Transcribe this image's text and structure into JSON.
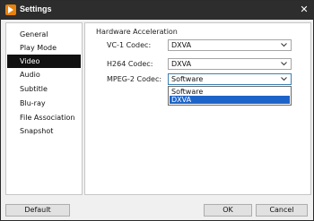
{
  "window": {
    "title": "Settings",
    "close_glyph": "✕"
  },
  "sidebar": {
    "items": [
      {
        "label": "General"
      },
      {
        "label": "Play Mode"
      },
      {
        "label": "Video"
      },
      {
        "label": "Audio"
      },
      {
        "label": "Subtitle"
      },
      {
        "label": "Blu-ray"
      },
      {
        "label": "File Association"
      },
      {
        "label": "Snapshot"
      }
    ],
    "selected": "Video"
  },
  "panel": {
    "section_title": "Hardware Acceleration",
    "rows": [
      {
        "label": "VC-1 Codec:",
        "value": "DXVA"
      },
      {
        "label": "H264 Codec:",
        "value": "DXVA"
      },
      {
        "label": "MPEG-2 Codec:",
        "value": "Software"
      }
    ],
    "open_dropdown": {
      "options": [
        "Software",
        "DXVA"
      ],
      "highlighted": "DXVA"
    }
  },
  "footer": {
    "default_label": "Default",
    "ok_label": "OK",
    "cancel_label": "Cancel"
  },
  "colors": {
    "titlebar": "#2d2d2d",
    "selected_nav": "#111111",
    "highlight": "#1e64c8",
    "app_icon": "#e8820c"
  },
  "icons": {
    "app": "play-logo-icon",
    "close": "close-icon",
    "dropdown": "chevron-down-icon"
  }
}
